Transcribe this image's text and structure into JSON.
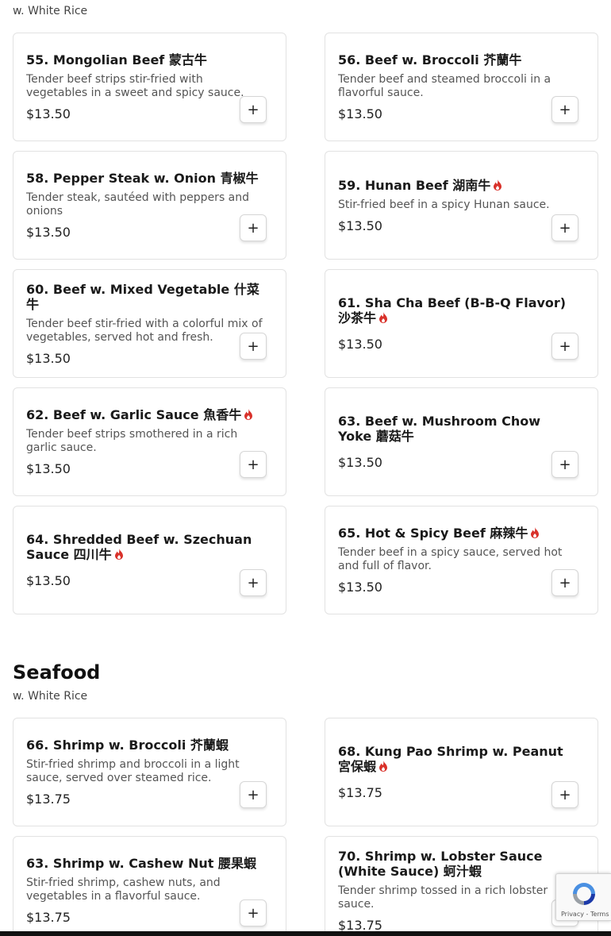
{
  "sections": [
    {
      "name": "",
      "subtitle": "w. White Rice"
    },
    {
      "name": "Seafood",
      "subtitle": "w. White Rice"
    }
  ],
  "items": [
    {
      "title": "55. Mongolian Beef 蒙古牛",
      "desc": "Tender beef strips stir-fried with vegetables in a sweet and spicy sauce.",
      "price": "$13.50",
      "spicy": false
    },
    {
      "title": "56. Beef w. Broccoli 芥蘭牛",
      "desc": "Tender beef and steamed broccoli in a flavorful sauce.",
      "price": "$13.50",
      "spicy": false
    },
    {
      "title": "58. Pepper Steak w. Onion 青椒牛",
      "desc": "Tender steak, sautéed with peppers and onions",
      "price": "$13.50",
      "spicy": false
    },
    {
      "title": "59. Hunan Beef 湖南牛",
      "desc": "Stir-fried beef in a spicy Hunan sauce.",
      "price": "$13.50",
      "spicy": true
    },
    {
      "title": "60. Beef w. Mixed Vegetable 什菜牛",
      "desc": "Tender beef stir-fried with a colorful mix of vegetables, served hot and fresh.",
      "price": "$13.50",
      "spicy": false
    },
    {
      "title": "61. Sha Cha Beef (B-B-Q Flavor) 沙茶牛",
      "desc": "",
      "price": "$13.50",
      "spicy": true
    },
    {
      "title": "62. Beef w. Garlic Sauce 魚香牛",
      "desc": "Tender beef strips smothered in a rich garlic sauce.",
      "price": "$13.50",
      "spicy": true
    },
    {
      "title": "63. Beef w. Mushroom Chow Yoke 蘑菇牛",
      "desc": "",
      "price": "$13.50",
      "spicy": false
    },
    {
      "title": "64. Shredded Beef w. Szechuan Sauce 四川牛",
      "desc": "",
      "price": "$13.50",
      "spicy": true
    },
    {
      "title": "65. Hot & Spicy Beef 麻辣牛",
      "desc": "Tender beef in a spicy sauce, served hot and full of flavor.",
      "price": "$13.50",
      "spicy": true
    },
    {
      "title": "66. Shrimp w. Broccoli 芥蘭蝦",
      "desc": "Stir-fried shrimp and broccoli in a light sauce, served over steamed rice.",
      "price": "$13.75",
      "spicy": false
    },
    {
      "title": "68. Kung Pao Shrimp w. Peanut 宮保蝦",
      "desc": "",
      "price": "$13.75",
      "spicy": true
    },
    {
      "title": "63. Shrimp w. Cashew Nut 腰果蝦",
      "desc": "Stir-fried shrimp, cashew nuts, and vegetables in a flavorful sauce.",
      "price": "$13.75",
      "spicy": false
    },
    {
      "title": "70. Shrimp w. Lobster Sauce (White Sauce) 蚵汁蝦",
      "desc": "Tender shrimp tossed in a rich lobster sauce.",
      "price": "$13.75",
      "spicy": false
    }
  ],
  "add_button_label": "+",
  "recaptcha": {
    "links": "Privacy - Terms"
  },
  "colors": {
    "spicy": "#d9322b",
    "border": "#e2e2e2",
    "text": "#1c1c1c"
  },
  "icons": {
    "spicy": "flame-icon",
    "add": "plus-icon",
    "captcha": "recaptcha-icon"
  }
}
